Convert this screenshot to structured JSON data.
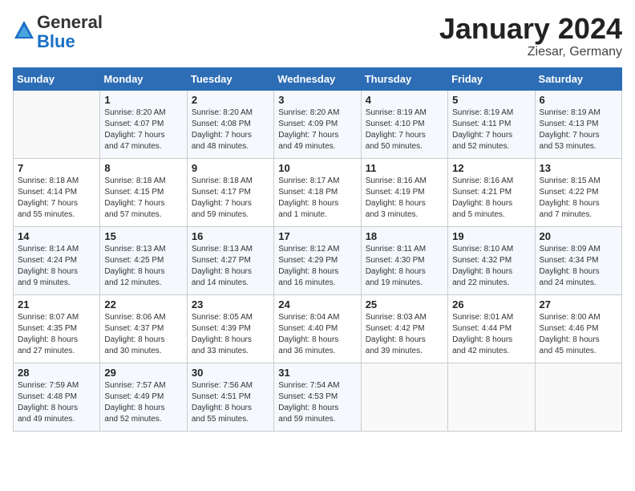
{
  "header": {
    "logo_general": "General",
    "logo_blue": "Blue",
    "month_title": "January 2024",
    "location": "Ziesar, Germany"
  },
  "calendar": {
    "days_of_week": [
      "Sunday",
      "Monday",
      "Tuesday",
      "Wednesday",
      "Thursday",
      "Friday",
      "Saturday"
    ],
    "weeks": [
      [
        {
          "day": "",
          "info": ""
        },
        {
          "day": "1",
          "info": "Sunrise: 8:20 AM\nSunset: 4:07 PM\nDaylight: 7 hours\nand 47 minutes."
        },
        {
          "day": "2",
          "info": "Sunrise: 8:20 AM\nSunset: 4:08 PM\nDaylight: 7 hours\nand 48 minutes."
        },
        {
          "day": "3",
          "info": "Sunrise: 8:20 AM\nSunset: 4:09 PM\nDaylight: 7 hours\nand 49 minutes."
        },
        {
          "day": "4",
          "info": "Sunrise: 8:19 AM\nSunset: 4:10 PM\nDaylight: 7 hours\nand 50 minutes."
        },
        {
          "day": "5",
          "info": "Sunrise: 8:19 AM\nSunset: 4:11 PM\nDaylight: 7 hours\nand 52 minutes."
        },
        {
          "day": "6",
          "info": "Sunrise: 8:19 AM\nSunset: 4:13 PM\nDaylight: 7 hours\nand 53 minutes."
        }
      ],
      [
        {
          "day": "7",
          "info": "Sunrise: 8:18 AM\nSunset: 4:14 PM\nDaylight: 7 hours\nand 55 minutes."
        },
        {
          "day": "8",
          "info": "Sunrise: 8:18 AM\nSunset: 4:15 PM\nDaylight: 7 hours\nand 57 minutes."
        },
        {
          "day": "9",
          "info": "Sunrise: 8:18 AM\nSunset: 4:17 PM\nDaylight: 7 hours\nand 59 minutes."
        },
        {
          "day": "10",
          "info": "Sunrise: 8:17 AM\nSunset: 4:18 PM\nDaylight: 8 hours\nand 1 minute."
        },
        {
          "day": "11",
          "info": "Sunrise: 8:16 AM\nSunset: 4:19 PM\nDaylight: 8 hours\nand 3 minutes."
        },
        {
          "day": "12",
          "info": "Sunrise: 8:16 AM\nSunset: 4:21 PM\nDaylight: 8 hours\nand 5 minutes."
        },
        {
          "day": "13",
          "info": "Sunrise: 8:15 AM\nSunset: 4:22 PM\nDaylight: 8 hours\nand 7 minutes."
        }
      ],
      [
        {
          "day": "14",
          "info": "Sunrise: 8:14 AM\nSunset: 4:24 PM\nDaylight: 8 hours\nand 9 minutes."
        },
        {
          "day": "15",
          "info": "Sunrise: 8:13 AM\nSunset: 4:25 PM\nDaylight: 8 hours\nand 12 minutes."
        },
        {
          "day": "16",
          "info": "Sunrise: 8:13 AM\nSunset: 4:27 PM\nDaylight: 8 hours\nand 14 minutes."
        },
        {
          "day": "17",
          "info": "Sunrise: 8:12 AM\nSunset: 4:29 PM\nDaylight: 8 hours\nand 16 minutes."
        },
        {
          "day": "18",
          "info": "Sunrise: 8:11 AM\nSunset: 4:30 PM\nDaylight: 8 hours\nand 19 minutes."
        },
        {
          "day": "19",
          "info": "Sunrise: 8:10 AM\nSunset: 4:32 PM\nDaylight: 8 hours\nand 22 minutes."
        },
        {
          "day": "20",
          "info": "Sunrise: 8:09 AM\nSunset: 4:34 PM\nDaylight: 8 hours\nand 24 minutes."
        }
      ],
      [
        {
          "day": "21",
          "info": "Sunrise: 8:07 AM\nSunset: 4:35 PM\nDaylight: 8 hours\nand 27 minutes."
        },
        {
          "day": "22",
          "info": "Sunrise: 8:06 AM\nSunset: 4:37 PM\nDaylight: 8 hours\nand 30 minutes."
        },
        {
          "day": "23",
          "info": "Sunrise: 8:05 AM\nSunset: 4:39 PM\nDaylight: 8 hours\nand 33 minutes."
        },
        {
          "day": "24",
          "info": "Sunrise: 8:04 AM\nSunset: 4:40 PM\nDaylight: 8 hours\nand 36 minutes."
        },
        {
          "day": "25",
          "info": "Sunrise: 8:03 AM\nSunset: 4:42 PM\nDaylight: 8 hours\nand 39 minutes."
        },
        {
          "day": "26",
          "info": "Sunrise: 8:01 AM\nSunset: 4:44 PM\nDaylight: 8 hours\nand 42 minutes."
        },
        {
          "day": "27",
          "info": "Sunrise: 8:00 AM\nSunset: 4:46 PM\nDaylight: 8 hours\nand 45 minutes."
        }
      ],
      [
        {
          "day": "28",
          "info": "Sunrise: 7:59 AM\nSunset: 4:48 PM\nDaylight: 8 hours\nand 49 minutes."
        },
        {
          "day": "29",
          "info": "Sunrise: 7:57 AM\nSunset: 4:49 PM\nDaylight: 8 hours\nand 52 minutes."
        },
        {
          "day": "30",
          "info": "Sunrise: 7:56 AM\nSunset: 4:51 PM\nDaylight: 8 hours\nand 55 minutes."
        },
        {
          "day": "31",
          "info": "Sunrise: 7:54 AM\nSunset: 4:53 PM\nDaylight: 8 hours\nand 59 minutes."
        },
        {
          "day": "",
          "info": ""
        },
        {
          "day": "",
          "info": ""
        },
        {
          "day": "",
          "info": ""
        }
      ]
    ]
  }
}
